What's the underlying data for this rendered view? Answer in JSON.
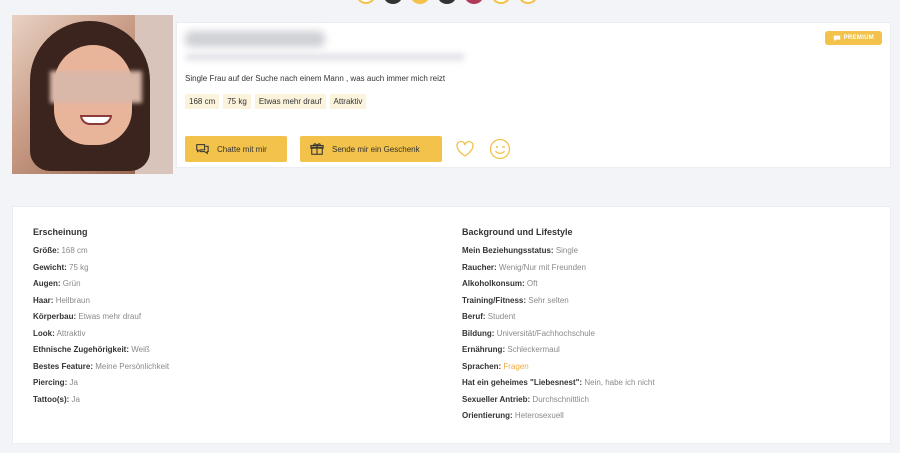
{
  "profile": {
    "headline": "Single Frau auf der Suche nach einem Mann , was auch immer mich reizt",
    "badge": "PREMIUM",
    "tags": [
      "168 cm",
      "75 kg",
      "Etwas mehr drauf",
      "Attraktiv"
    ],
    "actions": {
      "chat_label": "Chatte mit mir",
      "gift_label": "Sende mir ein Geschenk"
    }
  },
  "appearance": {
    "title": "Erscheinung",
    "rows": [
      {
        "label": "Größe",
        "value": "168 cm"
      },
      {
        "label": "Gewicht",
        "value": "75 kg"
      },
      {
        "label": "Augen",
        "value": "Grün"
      },
      {
        "label": "Haar",
        "value": "Hellbraun"
      },
      {
        "label": "Körperbau",
        "value": "Etwas mehr drauf"
      },
      {
        "label": "Look",
        "value": "Attraktiv"
      },
      {
        "label": "Ethnische Zugehörigkeit",
        "value": "Weiß"
      },
      {
        "label": "Bestes Feature",
        "value": "Meine Persönlichkeit"
      },
      {
        "label": "Piercing",
        "value": "Ja"
      },
      {
        "label": "Tattoo(s)",
        "value": "Ja"
      }
    ]
  },
  "lifestyle": {
    "title": "Background und Lifestyle",
    "rows": [
      {
        "label": "Mein Beziehungsstatus",
        "value": "Single"
      },
      {
        "label": "Raucher",
        "value": "Wenig/Nur mit Freunden"
      },
      {
        "label": "Alkoholkonsum",
        "value": "Oft"
      },
      {
        "label": "Training/Fitness",
        "value": "Sehr selten"
      },
      {
        "label": "Beruf",
        "value": "Student"
      },
      {
        "label": "Bildung",
        "value": "Universität/Fachhochschule"
      },
      {
        "label": "Ernährung",
        "value": "Schleckermaul"
      },
      {
        "label": "Sprachen",
        "value": "Fragen"
      },
      {
        "label": "Hat ein geheimes \"Liebesnest\"",
        "value": "Nein, habe ich nicht"
      },
      {
        "label": "Sexueller Antrieb",
        "value": "Durchschnittlich"
      },
      {
        "label": "Orientierung",
        "value": "Heterosexuell"
      }
    ]
  },
  "colors": {
    "accent": "#f2c24b",
    "link": "#f2a93b",
    "background": "#f3f4f8"
  }
}
